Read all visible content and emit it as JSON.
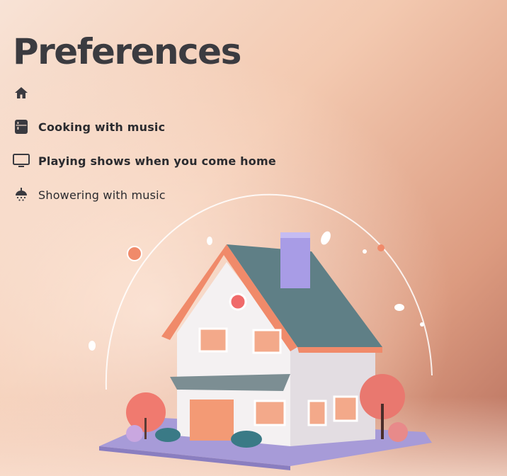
{
  "page": {
    "title": "Preferences"
  },
  "preferences": [
    {
      "icon": "home-icon",
      "label": ""
    },
    {
      "icon": "fridge-icon",
      "label": "Cooking with music"
    },
    {
      "icon": "tv-icon",
      "label": "Playing shows when you come home"
    },
    {
      "icon": "shower-icon",
      "label": "Showering with music"
    }
  ],
  "colors": {
    "background_top": "#f8e3d6",
    "background_bottom": "#b7705e",
    "text": "#2b2b2f",
    "title": "#3b3b40",
    "roof": "#5f7f86",
    "trim": "#f08a6a",
    "chimney": "#a89ce6"
  }
}
